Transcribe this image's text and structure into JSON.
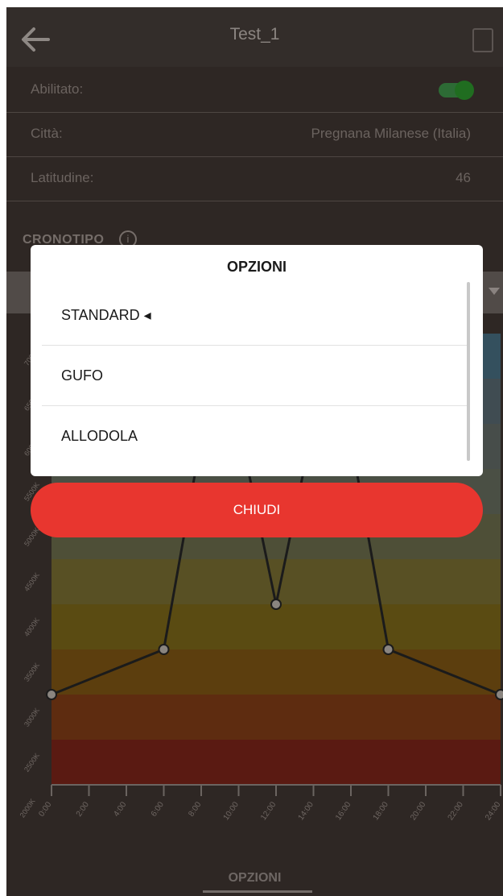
{
  "header": {
    "title": "Test_1"
  },
  "settings": [
    {
      "label": "Abilitato:",
      "value": ""
    },
    {
      "label": "Città:",
      "value": "Pregnana Milanese (Italia)"
    },
    {
      "label": "Latitudine:",
      "value": "46"
    }
  ],
  "section": {
    "label": "CRONOTIPO"
  },
  "chart_data": {
    "type": "line",
    "title": "",
    "xlabel": "",
    "ylabel": "",
    "x": [
      "0:00",
      "2:00",
      "4:00",
      "6:00",
      "8:00",
      "10:00",
      "12:00",
      "14:00",
      "16:00",
      "18:00",
      "20:00",
      "22:00",
      "24:00"
    ],
    "y_ticks": [
      "2500K",
      "3000K",
      "3500K",
      "4000K",
      "4500K",
      "5000K",
      "5500K",
      "6000K",
      "6500K",
      "7000K"
    ],
    "first_tick": "2000K",
    "series": [
      {
        "points": [
          [
            0,
            3000
          ],
          [
            6,
            3500
          ],
          [
            12,
            4000
          ],
          [
            18,
            3500
          ],
          [
            24,
            3000
          ]
        ]
      }
    ],
    "ylim": [
      2000,
      7000
    ]
  },
  "dialog": {
    "title": "OPZIONI",
    "options": [
      "STANDARD ◂",
      "GUFO",
      "ALLODOLA"
    ],
    "close_label": "CHIUDI"
  },
  "bottom_tab": {
    "label": "OPZIONI"
  }
}
